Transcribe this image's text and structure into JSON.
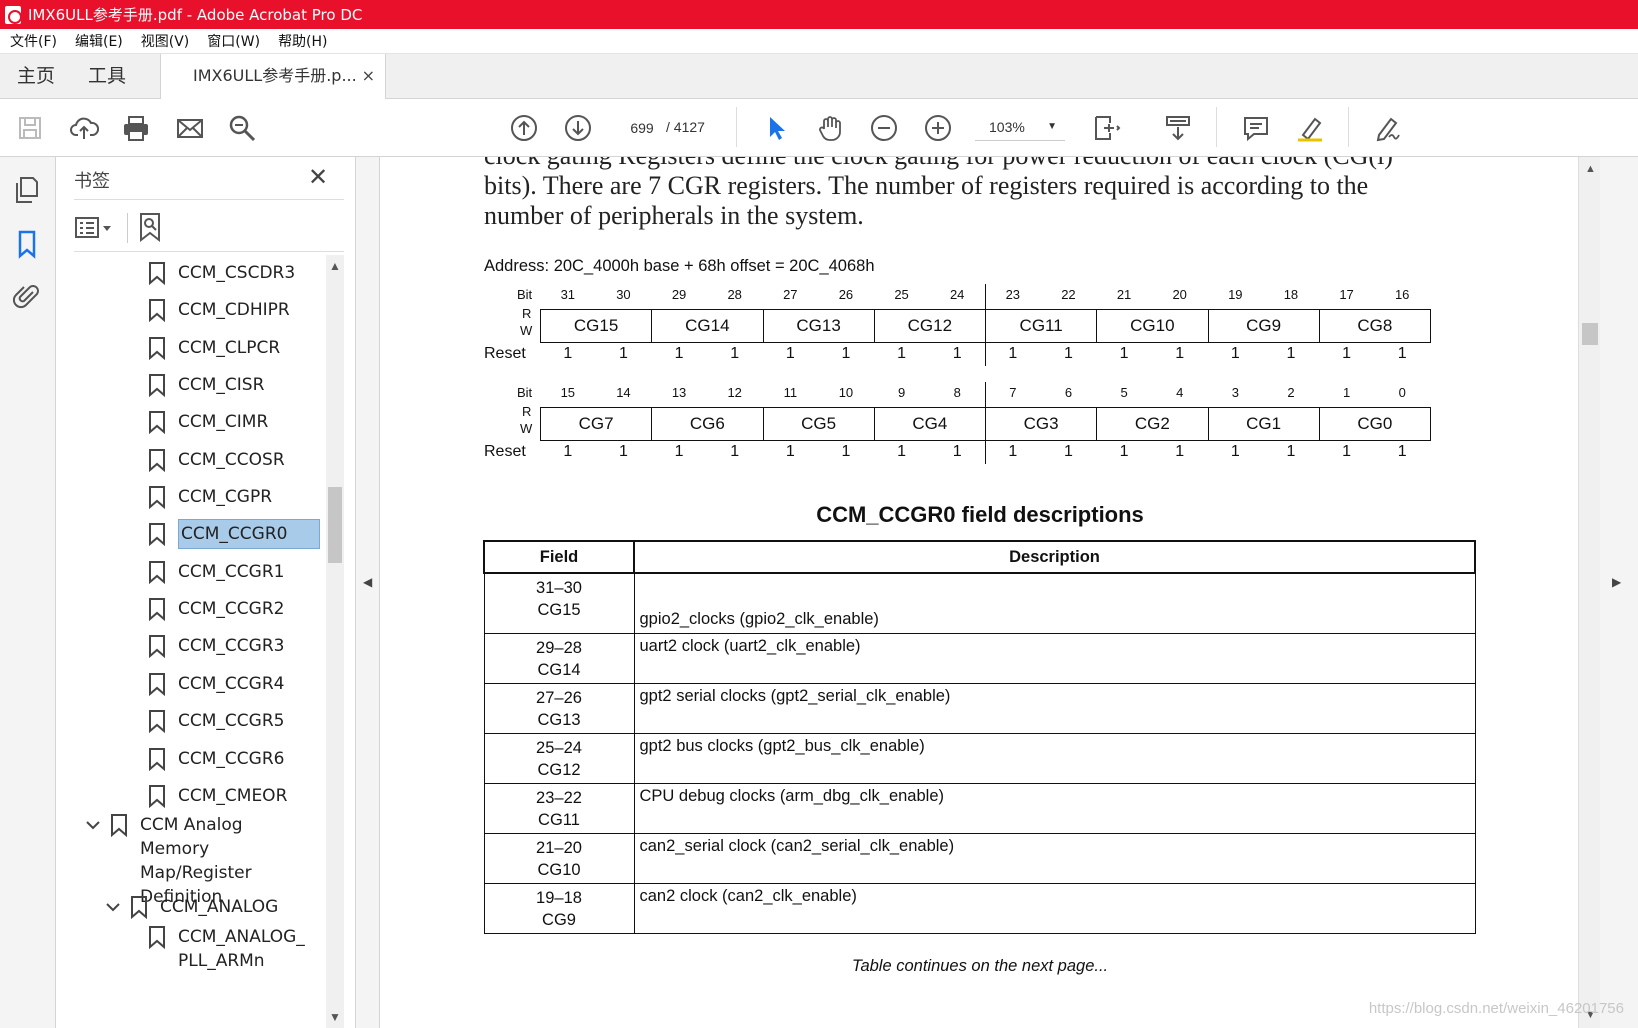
{
  "window": {
    "title": "IMX6ULL参考手册.pdf - Adobe Acrobat Pro DC"
  },
  "menu": [
    "文件(F)",
    "编辑(E)",
    "视图(V)",
    "窗口(W)",
    "帮助(H)"
  ],
  "tabs": {
    "home": "主页",
    "tools": "工具",
    "doc": "IMX6ULL参考手册.p...",
    "close": "×"
  },
  "toolbar": {
    "page_current": "699",
    "page_total": "/ 4127",
    "zoom": "103%",
    "zoom_caret": "▼"
  },
  "bookmarks": {
    "title": "书签",
    "close": "✕",
    "items": [
      {
        "label": "CCM_CSCDR3"
      },
      {
        "label": "CCM_CDHIPR"
      },
      {
        "label": "CCM_CLPCR"
      },
      {
        "label": "CCM_CISR"
      },
      {
        "label": "CCM_CIMR"
      },
      {
        "label": "CCM_CCOSR"
      },
      {
        "label": "CCM_CGPR"
      },
      {
        "label": "CCM_CCGR0",
        "selected": true
      },
      {
        "label": "CCM_CCGR1"
      },
      {
        "label": "CCM_CCGR2"
      },
      {
        "label": "CCM_CCGR3"
      },
      {
        "label": "CCM_CCGR4"
      },
      {
        "label": "CCM_CCGR5"
      },
      {
        "label": "CCM_CCGR6"
      },
      {
        "label": "CCM_CMEOR"
      },
      {
        "label": "CCM Analog Memory Map/Register Definition"
      },
      {
        "label": "CCM_ANALOG"
      },
      {
        "label": "CCM_ANALOG_PLL_ARMn"
      }
    ]
  },
  "document": {
    "para_line1": "clock gating Registers define the clock gating for power reduction of each clock (CG(i)",
    "para_line2": "bits). There are 7 CGR registers. The number of registers required is according to the",
    "para_line3": "number of peripherals in the system.",
    "address": "Address: 20C_4000h base + 68h offset = 20C_4068h",
    "reg_labels": {
      "bit": "Bit",
      "r": "R",
      "w": "W",
      "reset": "Reset"
    },
    "reg_high": {
      "bits": [
        "31",
        "30",
        "29",
        "28",
        "27",
        "26",
        "25",
        "24",
        "23",
        "22",
        "21",
        "20",
        "19",
        "18",
        "17",
        "16"
      ],
      "fields": [
        "CG15",
        "CG14",
        "CG13",
        "CG12",
        "CG11",
        "CG10",
        "CG9",
        "CG8"
      ],
      "reset": [
        "1",
        "1",
        "1",
        "1",
        "1",
        "1",
        "1",
        "1",
        "1",
        "1",
        "1",
        "1",
        "1",
        "1",
        "1",
        "1"
      ]
    },
    "reg_low": {
      "bits": [
        "15",
        "14",
        "13",
        "12",
        "11",
        "10",
        "9",
        "8",
        "7",
        "6",
        "5",
        "4",
        "3",
        "2",
        "1",
        "0"
      ],
      "fields": [
        "CG7",
        "CG6",
        "CG5",
        "CG4",
        "CG3",
        "CG2",
        "CG1",
        "CG0"
      ],
      "reset": [
        "1",
        "1",
        "1",
        "1",
        "1",
        "1",
        "1",
        "1",
        "1",
        "1",
        "1",
        "1",
        "1",
        "1",
        "1",
        "1"
      ]
    },
    "fd_title": "CCM_CCGR0 field descriptions",
    "fd_header": {
      "field": "Field",
      "description": "Description"
    },
    "fd_rows": [
      {
        "bits": "31–30",
        "name": "CG15",
        "desc": "gpio2_clocks (gpio2_clk_enable)"
      },
      {
        "bits": "29–28",
        "name": "CG14",
        "desc": "uart2 clock (uart2_clk_enable)"
      },
      {
        "bits": "27–26",
        "name": "CG13",
        "desc": "gpt2 serial clocks (gpt2_serial_clk_enable)"
      },
      {
        "bits": "25–24",
        "name": "CG12",
        "desc": "gpt2 bus clocks (gpt2_bus_clk_enable)"
      },
      {
        "bits": "23–22",
        "name": "CG11",
        "desc": "CPU debug clocks (arm_dbg_clk_enable)"
      },
      {
        "bits": "21–20",
        "name": "CG10",
        "desc": "can2_serial clock (can2_serial_clk_enable)"
      },
      {
        "bits": "19–18",
        "name": "CG9",
        "desc": "can2 clock (can2_clk_enable)"
      }
    ],
    "continued": "Table continues on the next page..."
  },
  "watermark": "https://blog.csdn.net/weixin_46201756"
}
